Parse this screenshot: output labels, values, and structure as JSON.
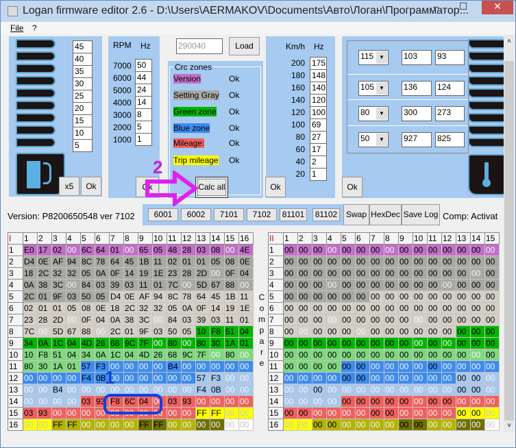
{
  "window": {
    "title": "Logan firmware editor 2.6 - D:\\Users\\AERMAKOV\\Documents\\Авто\\Логан\\Программатор...",
    "minimize": "–",
    "maximize": "☐",
    "close": "✕"
  },
  "menu": {
    "file": "File",
    "help": "?"
  },
  "fuel": {
    "values": [
      "45",
      "40",
      "35",
      "30",
      "25",
      "20",
      "15",
      "10",
      "5"
    ],
    "x5": "x5",
    "ok": "Ok"
  },
  "rpm": {
    "h1": "RPM",
    "h2": "Hz",
    "rows": [
      [
        "7000",
        "50"
      ],
      [
        "6000",
        "44"
      ],
      [
        "5000",
        "24"
      ],
      [
        "4000",
        "14"
      ],
      [
        "3000",
        "8"
      ],
      [
        "2000",
        "5"
      ],
      [
        "1000",
        "1"
      ]
    ],
    "ok": "Ok"
  },
  "file_id": {
    "value": "290040",
    "load": "Load"
  },
  "crc": {
    "title": "Crc zones",
    "zones": [
      {
        "name": "Version",
        "status": "Ok",
        "color": "#c070c8"
      },
      {
        "name": "Setting Gray",
        "status": "Ok",
        "color": "#a8a8a4"
      },
      {
        "name": "Green zone",
        "status": "Ok",
        "color": "#00b400"
      },
      {
        "name": "Blue zone",
        "status": "Ok",
        "color": "#3c8cf0"
      },
      {
        "name": "Mileage:",
        "status": "Ok",
        "color": "#f06060"
      },
      {
        "name": "Trip mileage",
        "status": "Ok",
        "color": "#ffff00"
      }
    ],
    "calc_all": "Calc all"
  },
  "speed": {
    "h1": "Km/h",
    "h2": "Hz",
    "rows": [
      [
        "200",
        "175"
      ],
      [
        "180",
        "148"
      ],
      [
        "160",
        "140"
      ],
      [
        "140",
        "120"
      ],
      [
        "120",
        "100"
      ],
      [
        "100",
        "69"
      ],
      [
        "80",
        "27"
      ],
      [
        "60",
        "17"
      ],
      [
        "40",
        "2"
      ],
      [
        "20",
        "1"
      ]
    ],
    "ok": "Ok"
  },
  "temp": {
    "rows": [
      [
        "115",
        "103",
        "93"
      ],
      [
        "105",
        "136",
        "124"
      ],
      [
        "80",
        "300",
        "273"
      ],
      [
        "50",
        "927",
        "825"
      ]
    ],
    "ok": "Ok"
  },
  "version": "Version: P8200650548 ver 7102",
  "version_buttons": [
    "6001",
    "6002",
    "7101",
    "7102",
    "81101",
    "81102"
  ],
  "tools": {
    "swap": "Swap",
    "hexdec": "HexDec",
    "save_log": "Save Log",
    "comp": "Comp: Activat"
  },
  "compare_label": [
    "C",
    "o",
    "m",
    "p",
    "a",
    "r",
    "e"
  ],
  "annotations": {
    "one": "1",
    "two": "2"
  },
  "zone_colors": {
    "P": "#c070c8",
    "G": "#a8a8a4",
    "L": "#d4d0c8",
    "g": "#00b400",
    "l": "#80d880",
    "B": "#3c8cf0",
    "b": "#a8c8f0",
    "R": "#f06060",
    "Y": "#ffff00",
    "O": "#b4b400",
    "D": "#707000",
    "W": "#ffffff"
  },
  "grid1": {
    "corner": "I",
    "cols": [
      "1",
      "2",
      "3",
      "4",
      "5",
      "6",
      "7",
      "8",
      "9",
      "10",
      "11",
      "12",
      "13",
      "14",
      "15",
      "16"
    ],
    "rows": [
      {
        "n": "1",
        "zones": "PPPPPPPPPPPPPPPP",
        "faded": [
          4,
          8,
          15
        ],
        "cells": [
          "E0",
          "17",
          "02",
          "00",
          "6C",
          "64",
          "01",
          "00",
          "65",
          "05",
          "48",
          "28",
          "03",
          "08",
          "00",
          "4E"
        ]
      },
      {
        "n": "2",
        "zones": "GGGGGGGGGGGGGGGG",
        "faded": [],
        "cells": [
          "D4",
          "0E",
          "AF",
          "94",
          "8C",
          "78",
          "64",
          "45",
          "1B",
          "11",
          "02",
          "01",
          "01",
          "05",
          "08",
          "0E"
        ]
      },
      {
        "n": "3",
        "zones": "GGGGGGGGGGGGGGGG",
        "faded": [
          14
        ],
        "cells": [
          "18",
          "2C",
          "32",
          "32",
          "05",
          "0A",
          "0F",
          "14",
          "19",
          "1E",
          "23",
          "28",
          "2D",
          "00",
          "0F",
          "04"
        ]
      },
      {
        "n": "4",
        "zones": "GGGGGGGGGGGGGGGG",
        "faded": [
          4,
          12,
          16
        ],
        "cells": [
          "0A",
          "38",
          "3C",
          "00",
          "84",
          "03",
          "39",
          "03",
          "11",
          "01",
          "7C",
          "00",
          "5D",
          "67",
          "88",
          "00"
        ]
      },
      {
        "n": "5",
        "zones": "GGGGGGLLLLLLLLLL",
        "faded": [],
        "cells": [
          "2C",
          "01",
          "9F",
          "03",
          "50",
          "05",
          "D4",
          "0E",
          "AF",
          "94",
          "8C",
          "78",
          "64",
          "45",
          "1B",
          "11"
        ]
      },
      {
        "n": "6",
        "zones": "LLLLLLLLLLLLLLLL",
        "faded": [],
        "cells": [
          "02",
          "01",
          "01",
          "05",
          "08",
          "0E",
          "18",
          "2C",
          "32",
          "32",
          "05",
          "0A",
          "0F",
          "14",
          "19",
          "1E"
        ]
      },
      {
        "n": "7",
        "zones": "LLLLLLLLLLLLLLLL",
        "faded": [
          4,
          10
        ],
        "cells": [
          "23",
          "28",
          "2D",
          "00",
          "0F",
          "04",
          "0A",
          "38",
          "3C",
          "00",
          "84",
          "03",
          "39",
          "03",
          "11",
          "01"
        ]
      },
      {
        "n": "8",
        "zones": "LLLLLLLLLLLLgggg",
        "faded": [
          2,
          6
        ],
        "cells": [
          "7C",
          "00",
          "5D",
          "67",
          "88",
          "00",
          "2C",
          "01",
          "9F",
          "03",
          "50",
          "05",
          "10",
          "F8",
          "51",
          "04"
        ]
      },
      {
        "n": "9",
        "zones": "gggggggggggggggg",
        "faded": [
          10,
          12
        ],
        "cells": [
          "34",
          "0A",
          "1C",
          "04",
          "4D",
          "26",
          "68",
          "9C",
          "7F",
          "00",
          "80",
          "00",
          "80",
          "30",
          "1A",
          "01"
        ]
      },
      {
        "n": "10",
        "zones": "llllllllllllllll",
        "faded": [
          14,
          16
        ],
        "cells": [
          "10",
          "F8",
          "51",
          "04",
          "34",
          "0A",
          "1C",
          "04",
          "4D",
          "26",
          "68",
          "9C",
          "7F",
          "00",
          "80",
          "00"
        ]
      },
      {
        "n": "11",
        "zones": "llllBBBBBBBBBBBB",
        "faded": [
          7,
          8,
          9,
          10,
          12,
          13,
          14,
          15,
          16
        ],
        "cells": [
          "80",
          "30",
          "1A",
          "01",
          "57",
          "F3",
          "00",
          "00",
          "00",
          "00",
          "B4",
          "00",
          "00",
          "00",
          "00",
          "00"
        ]
      },
      {
        "n": "12",
        "zones": "BBBBBBBBBBBBbbbb",
        "faded": [
          1,
          2,
          3,
          4,
          7,
          8,
          9,
          10,
          11,
          12,
          15,
          16
        ],
        "cells": [
          "00",
          "00",
          "00",
          "00",
          "F4",
          "0B",
          "00",
          "00",
          "00",
          "00",
          "00",
          "00",
          "57",
          "F3",
          "00",
          "00"
        ]
      },
      {
        "n": "13",
        "zones": "bbbbbbbbbbbbbbbb",
        "faded": [
          1,
          2,
          4,
          5,
          6,
          7,
          8,
          9,
          10,
          11,
          12,
          15,
          16
        ],
        "cells": [
          "00",
          "00",
          "B4",
          "00",
          "00",
          "00",
          "00",
          "00",
          "00",
          "00",
          "00",
          "00",
          "F4",
          "0B",
          "00",
          "00"
        ]
      },
      {
        "n": "14",
        "zones": "bbbbRRRRRRRRRRRR",
        "faded": [
          1,
          2,
          3,
          4,
          10,
          13,
          14,
          15,
          16
        ],
        "cells": [
          "00",
          "00",
          "00",
          "00",
          "03",
          "93",
          "F8",
          "6C",
          "04",
          "00",
          "03",
          "93",
          "00",
          "00",
          "00",
          "00"
        ]
      },
      {
        "n": "15",
        "zones": "RRRRRRRRRRRRYYYY",
        "faded": [
          3,
          4,
          5,
          6,
          7,
          8,
          9,
          10,
          11,
          12,
          15,
          16
        ],
        "cells": [
          "03",
          "93",
          "00",
          "00",
          "00",
          "00",
          "00",
          "00",
          "00",
          "00",
          "00",
          "00",
          "FF",
          "FF",
          "00",
          "00"
        ]
      },
      {
        "n": "16",
        "zones": "YYOOOOOODDOODDWW",
        "faded": [
          1,
          2,
          5,
          6,
          7,
          8,
          11,
          12,
          13,
          14,
          15,
          16
        ],
        "cells": [
          "00",
          "00",
          "FF",
          "FF",
          "00",
          "00",
          "00",
          "00",
          "FF",
          "FF",
          "00",
          "00",
          "00",
          "00",
          "00",
          "00"
        ]
      }
    ]
  },
  "grid2": {
    "corner": "II",
    "cols": [
      "1",
      "2",
      "3",
      "4",
      "5",
      "6",
      "7",
      "8",
      "9",
      "10",
      "11",
      "12",
      "13",
      "14",
      "15"
    ],
    "rows": [
      {
        "n": "1",
        "zones": "PPPPPPPPPPPPPPP",
        "faded": [
          4,
          8,
          15
        ]
      },
      {
        "n": "2",
        "zones": "GGGGGGGGGGGGGGG",
        "faded": []
      },
      {
        "n": "3",
        "zones": "GGGGGGGGGGGGGGG",
        "faded": [
          14
        ]
      },
      {
        "n": "4",
        "zones": "GGGGGGGGGGGGGGG",
        "faded": [
          4,
          12
        ]
      },
      {
        "n": "5",
        "zones": "GGGGGGLLLLLLLLL",
        "faded": []
      },
      {
        "n": "6",
        "zones": "LLLLLLLLLLLLLLL",
        "faded": []
      },
      {
        "n": "7",
        "zones": "LLLLLLLLLLLLLLL",
        "faded": [
          4,
          10
        ]
      },
      {
        "n": "8",
        "zones": "LLLLLLLLLLLLggg",
        "faded": [
          2,
          6
        ]
      },
      {
        "n": "9",
        "zones": "ggggggggggggggg",
        "faded": [
          10,
          12
        ]
      },
      {
        "n": "10",
        "zones": "lllllllllllllll",
        "faded": [
          14
        ]
      },
      {
        "n": "11",
        "zones": "llllBBBBBBBBBBB",
        "faded": [
          7,
          8,
          9,
          10,
          12,
          13,
          14,
          15
        ]
      },
      {
        "n": "12",
        "zones": "BBBBBBBBBBBBbbb",
        "faded": [
          1,
          2,
          3,
          4,
          7,
          8,
          9,
          10,
          11,
          12,
          15
        ]
      },
      {
        "n": "13",
        "zones": "bbbbbbbbbbbbbbb",
        "faded": [
          1,
          2,
          4,
          5,
          6,
          7,
          8,
          9,
          10,
          11,
          12,
          15
        ]
      },
      {
        "n": "14",
        "zones": "bbbbRRRRRRRRRRR",
        "faded": [
          1,
          2,
          3,
          4,
          10,
          13,
          14,
          15
        ]
      },
      {
        "n": "15",
        "zones": "RRRRRRRRRRRRYYY",
        "faded": [
          3,
          4,
          5,
          6,
          9,
          10,
          11,
          12,
          15
        ]
      },
      {
        "n": "16",
        "zones": "YYOOOOOODDOODDW",
        "faded": [
          1,
          2,
          5,
          6,
          7,
          8,
          11,
          12,
          13,
          14,
          15
        ]
      }
    ],
    "cell_value": "00"
  }
}
